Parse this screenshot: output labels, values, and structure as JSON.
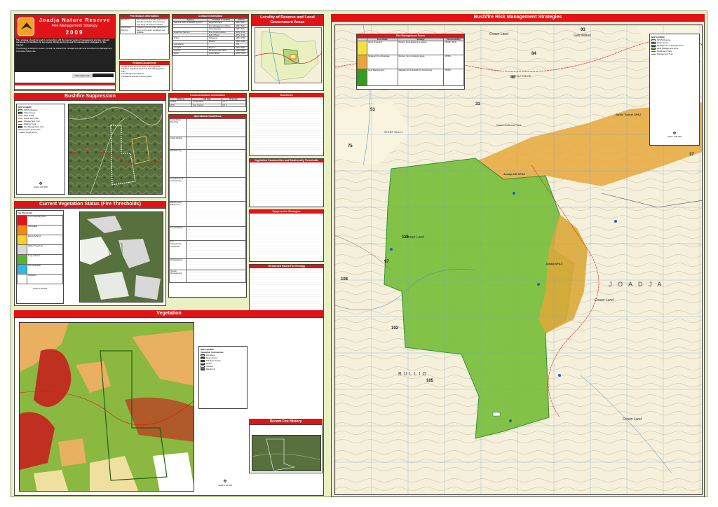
{
  "title_block": {
    "reserve": "Joadja Nature Reserve",
    "strategy": "Fire Management Strategy",
    "year": "2009",
    "intro": "This strategy should be read in conjunction with the reserve's plan of management and any relevant documents. It identifies the key assets, threats and proposed fire management strategies for the reserve.",
    "notes": "This strategy is subject to review. Consult the relevant fire management plan and local Bush Fire Management Committee before use.",
    "date_label": "Date Approved:"
  },
  "fire_season": {
    "title": "Fire Season Information",
    "rows": [
      {
        "label": "Bushfires",
        "text": "Fire seasons generally extend from October to March. Dry summers may bring the season forward."
      },
      {
        "label": "Prescribed Burning",
        "text": "Preferred period is late autumn to early spring when conditions are suitable."
      }
    ]
  },
  "related_docs": {
    "title": "Related Documents",
    "items": [
      "Joadja Nature Reserve Plan of Management",
      "Southern Highlands Bush Fire Risk Management Plan",
      "Fire Management Manual",
      "Threatened species recovery plans"
    ]
  },
  "contacts": {
    "title": "Contact Information",
    "headers": [
      "Agency",
      "Position / Location",
      "Phone"
    ],
    "rows": [
      [
        "National Parks & Wildlife Service",
        "Regional Office",
        "4887 8244"
      ],
      [
        "",
        "Fire Management Officer",
        "4887 8244"
      ],
      [
        "",
        "Area Manager",
        "4887 8244"
      ],
      [
        "Rural Fire Service",
        "Fire Control Centre",
        "4872 1711"
      ],
      [
        "",
        "Duty Officer",
        "4872 1711"
      ],
      [
        "Police",
        "Mittagong",
        "4860 2799"
      ],
      [
        "",
        "Bowral",
        "4861 0299"
      ],
      [
        "Ambulance",
        "",
        "000"
      ],
      [
        "Hospital",
        "Bowral",
        "4861 8000"
      ],
      [
        "Council",
        "Wingecarribee Shire",
        "4868 0888"
      ],
      [
        "Other",
        "Local Office",
        "4878 7205"
      ]
    ]
  },
  "locality": {
    "title": "Locality of Reserve and Local Government Areas"
  },
  "bushfire_suppression": {
    "title": "Bushfire Suppression",
    "legend_title": "MAP LEGEND",
    "legend": [
      "NPWS Reserve",
      "Other Tenure",
      "Main Roads",
      "Roads and Trails",
      "Management Trail",
      "Walking Track",
      "Fire Management zone",
      "Helicopter Landing Site",
      "Water Supply Point"
    ],
    "scale": "Scale 1:30 000"
  },
  "comms": {
    "title": "Communications Information",
    "headers": [
      "Channel",
      "Call Sign",
      "Repeater"
    ],
    "rows": [
      [
        "NPWS",
        "Joadja Base",
        "Ch 1"
      ],
      [
        "RFS",
        "Fire Control",
        "Ch 2"
      ]
    ]
  },
  "operational": {
    "title": "Operational Guidelines",
    "rows": [
      "Aerial Water Bombing",
      "Aerial Ignition",
      "Backburning",
      "Containment & Control Lines",
      "Earthmoving Equipment",
      "Fire Retardant",
      "Fire Suppression Chemicals",
      "Rehabilitation",
      "Smoke Management"
    ]
  },
  "fire_thresholds": {
    "title": "Current Vegetation Status (Fire Thresholds)",
    "legend_title": "Fire Thresholds",
    "items": [
      {
        "label": "Too Frequently Burnt",
        "color": "#e01418"
      },
      {
        "label": "Vulnerable",
        "color": "#f08a18"
      },
      {
        "label": "Recently Burnt",
        "color": "#f4d030"
      },
      {
        "label": "Within Threshold",
        "color": "#d8d8d8"
      },
      {
        "label": "Long Unburnt",
        "color": "#5bb030"
      },
      {
        "label": "Not Applicable",
        "color": "#30b8e0"
      },
      {
        "label": "Unknown",
        "color": "#ffffff"
      }
    ],
    "scale": "Scale 1:30 000"
  },
  "vegetation": {
    "title": "Vegetation",
    "legend_title": "MAP LEGEND",
    "communities_title": "Vegetation Communities",
    "items": [
      {
        "label": "Woodland",
        "color": "#e8b060"
      },
      {
        "label": "Open Forest",
        "color": "#8ab840"
      },
      {
        "label": "Tall Open Forest",
        "color": "#c03020"
      },
      {
        "label": "Heath",
        "color": "#f0e0a0"
      },
      {
        "label": "Cleared",
        "color": "#ffffff"
      },
      {
        "label": "Rainforest",
        "color": "#206010"
      }
    ],
    "scale": "Scale 1:30 000"
  },
  "suppression_strategies": {
    "title": "Suppression Strategies",
    "veg_title": "Vegetation Communities and Biodiversity Thresholds",
    "fauna_title": "Threatened Fauna Fire Ecology",
    "guidelines_title": "Guidelines",
    "recent_fire": "Recent Fire History"
  },
  "risk_strategies": {
    "title": "Bushfire Risk Management Strategies",
    "zones_title": "Fire Management Zones",
    "headers": [
      "Zone Name",
      "Strategy",
      "Responsibility"
    ],
    "rows": [
      [
        "Asset Protection",
        "Reduce fuels adjacent to assets",
        "NPWS / RFS"
      ],
      [
        "Strategic Fire Advantage",
        "Reduce fuel in strategic areas",
        "NPWS"
      ],
      [
        "Land Management",
        "Maintain fire thresholds for biodiversity",
        "NPWS"
      ]
    ],
    "legend_title": "MAP LEGEND",
    "legend": [
      "NPWS Reserve",
      "Other Tenure",
      "Strategic Fire Advantage Zone",
      "Land Management Zone",
      "Roads and Trails",
      "Management Trail"
    ],
    "scale": "Scale 1:30 000",
    "labels": {
      "crown1": "Crown Land",
      "crown2": "Crown Land",
      "crown3": "Crown Land",
      "crown4": "Crown Land",
      "joadja": "J O A D J A",
      "sfaz1": "Joadja SFAZ",
      "sfaz2": "Joadja NR SFAZ",
      "sfaz3": "Bullio Tunnel SFAZ",
      "bullio": "BULLIO",
      "wnp": "Nattai National Park",
      "steep": "STEEP GULLY",
      "ganzfellow": "Gansfellow",
      "wattleridge": "WATTLE RIDGE"
    },
    "parcels": [
      "93",
      "84",
      "40",
      "53",
      "75",
      "97",
      "108",
      "102",
      "105",
      "116",
      "18",
      "17",
      "31"
    ]
  }
}
